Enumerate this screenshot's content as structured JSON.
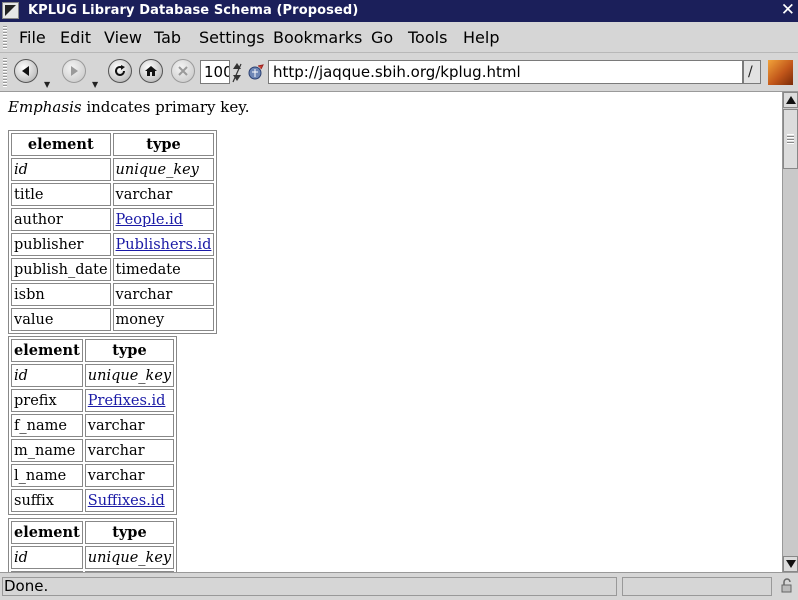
{
  "window": {
    "title": "KPLUG Library Database Schema (Proposed)"
  },
  "menubar": {
    "items": [
      "File",
      "Edit",
      "View",
      "Tab",
      "Settings",
      "Bookmarks",
      "Go",
      "Tools",
      "Help"
    ]
  },
  "toolbar": {
    "zoom_value": "100",
    "url": "http://jaqque.sbih.org/kplug.html",
    "url_dropdown_glyph": "/",
    "icons": [
      "back-arrow-icon",
      "forward-arrow-icon",
      "reload-icon",
      "home-icon",
      "stop-icon",
      "site-icon"
    ]
  },
  "content": {
    "intro_emphasis": "Emphasis",
    "intro_rest": " indcates primary key.",
    "tables": [
      {
        "headers": [
          "element",
          "type"
        ],
        "rows": [
          {
            "element": "id",
            "type": "unique_key",
            "key": true,
            "link": false
          },
          {
            "element": "title",
            "type": "varchar",
            "key": false,
            "link": false
          },
          {
            "element": "author",
            "type": "People.id",
            "key": false,
            "link": true
          },
          {
            "element": "publisher",
            "type": "Publishers.id",
            "key": false,
            "link": true
          },
          {
            "element": "publish_date",
            "type": "timedate",
            "key": false,
            "link": false
          },
          {
            "element": "isbn",
            "type": "varchar",
            "key": false,
            "link": false
          },
          {
            "element": "value",
            "type": "money",
            "key": false,
            "link": false
          }
        ]
      },
      {
        "headers": [
          "element",
          "type"
        ],
        "rows": [
          {
            "element": "id",
            "type": "unique_key",
            "key": true,
            "link": false
          },
          {
            "element": "prefix",
            "type": "Prefixes.id",
            "key": false,
            "link": true
          },
          {
            "element": "f_name",
            "type": "varchar",
            "key": false,
            "link": false
          },
          {
            "element": "m_name",
            "type": "varchar",
            "key": false,
            "link": false
          },
          {
            "element": "l_name",
            "type": "varchar",
            "key": false,
            "link": false
          },
          {
            "element": "suffix",
            "type": "Suffixes.id",
            "key": false,
            "link": true
          }
        ]
      },
      {
        "headers": [
          "element",
          "type"
        ],
        "rows": [
          {
            "element": "id",
            "type": "unique_key",
            "key": true,
            "link": false
          },
          {
            "element": "",
            "type": "",
            "key": false,
            "link": false
          }
        ]
      }
    ]
  },
  "status": {
    "text": "Done."
  },
  "colors": {
    "titlebar": "#1b1f5a",
    "link": "#1a1aa6",
    "chrome": "#d6d6d6"
  }
}
